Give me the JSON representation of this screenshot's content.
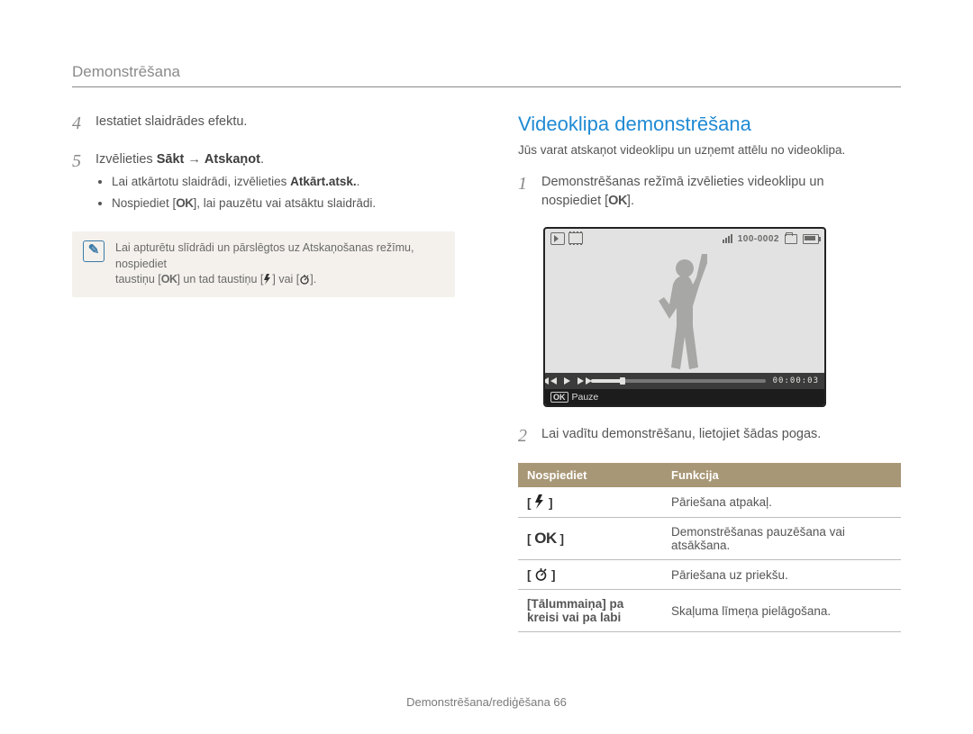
{
  "header": {
    "title": "Demonstrēšana"
  },
  "left": {
    "step4": {
      "num": "4",
      "text": "Iestatiet slaidrādes efektu."
    },
    "step5": {
      "num": "5",
      "lead": "Izvēlieties ",
      "bold1": "Sākt",
      "arrow": " → ",
      "bold2": "Atskaņot",
      "tail": ".",
      "b1_lead": "Lai atkārtotu slaidrādi, izvēlieties ",
      "b1_bold": "Atkārt.atsk.",
      "b1_tail": ".",
      "b2_lead": "Nospiediet [",
      "b2_ok": "OK",
      "b2_tail": "], lai pauzētu vai atsāktu slaidrādi."
    },
    "note": {
      "icon": "✎",
      "l1": "Lai apturētu slīdrādi un pārslēgtos uz Atskaņošanas režīmu, nospiediet",
      "l2_a": "taustiņu [",
      "l2_ok": "OK",
      "l2_b": "] un tad taustiņu [",
      "l2_c": "] vai [",
      "l2_d": "]."
    }
  },
  "right": {
    "title": "Videoklipa demonstrēšana",
    "sub": "Jūs varat atskaņot videoklipu un uzņemt attēlu no videoklipa.",
    "step1": {
      "num": "1",
      "l1": "Demonstrēšanas režīmā izvēlieties videoklipu un",
      "l2a": "nospiediet [",
      "l2ok": "OK",
      "l2b": "]."
    },
    "preview": {
      "counter": "100-0002",
      "time": "00:00:03",
      "pause": "Pauze",
      "ok": "OK"
    },
    "step2": {
      "num": "2",
      "text": "Lai vadītu demonstrēšanu, lietojiet šādas pogas."
    },
    "table": {
      "h1": "Nospiediet",
      "h2": "Funkcija",
      "rows": [
        {
          "key_type": "flash",
          "func": "Pāriešana atpakaļ."
        },
        {
          "key_type": "ok",
          "key_text": "OK",
          "func": "Demonstrēšanas pauzēšana vai atsākšana."
        },
        {
          "key_type": "timer",
          "func": "Pāriešana uz priekšu."
        },
        {
          "key_type": "text",
          "key_text": "[Tālummaiņa] pa kreisi vai pa labi",
          "func": "Skaļuma līmeņa pielāgošana."
        }
      ]
    }
  },
  "footer": {
    "text": "Demonstrēšana/rediģēšana  66"
  }
}
